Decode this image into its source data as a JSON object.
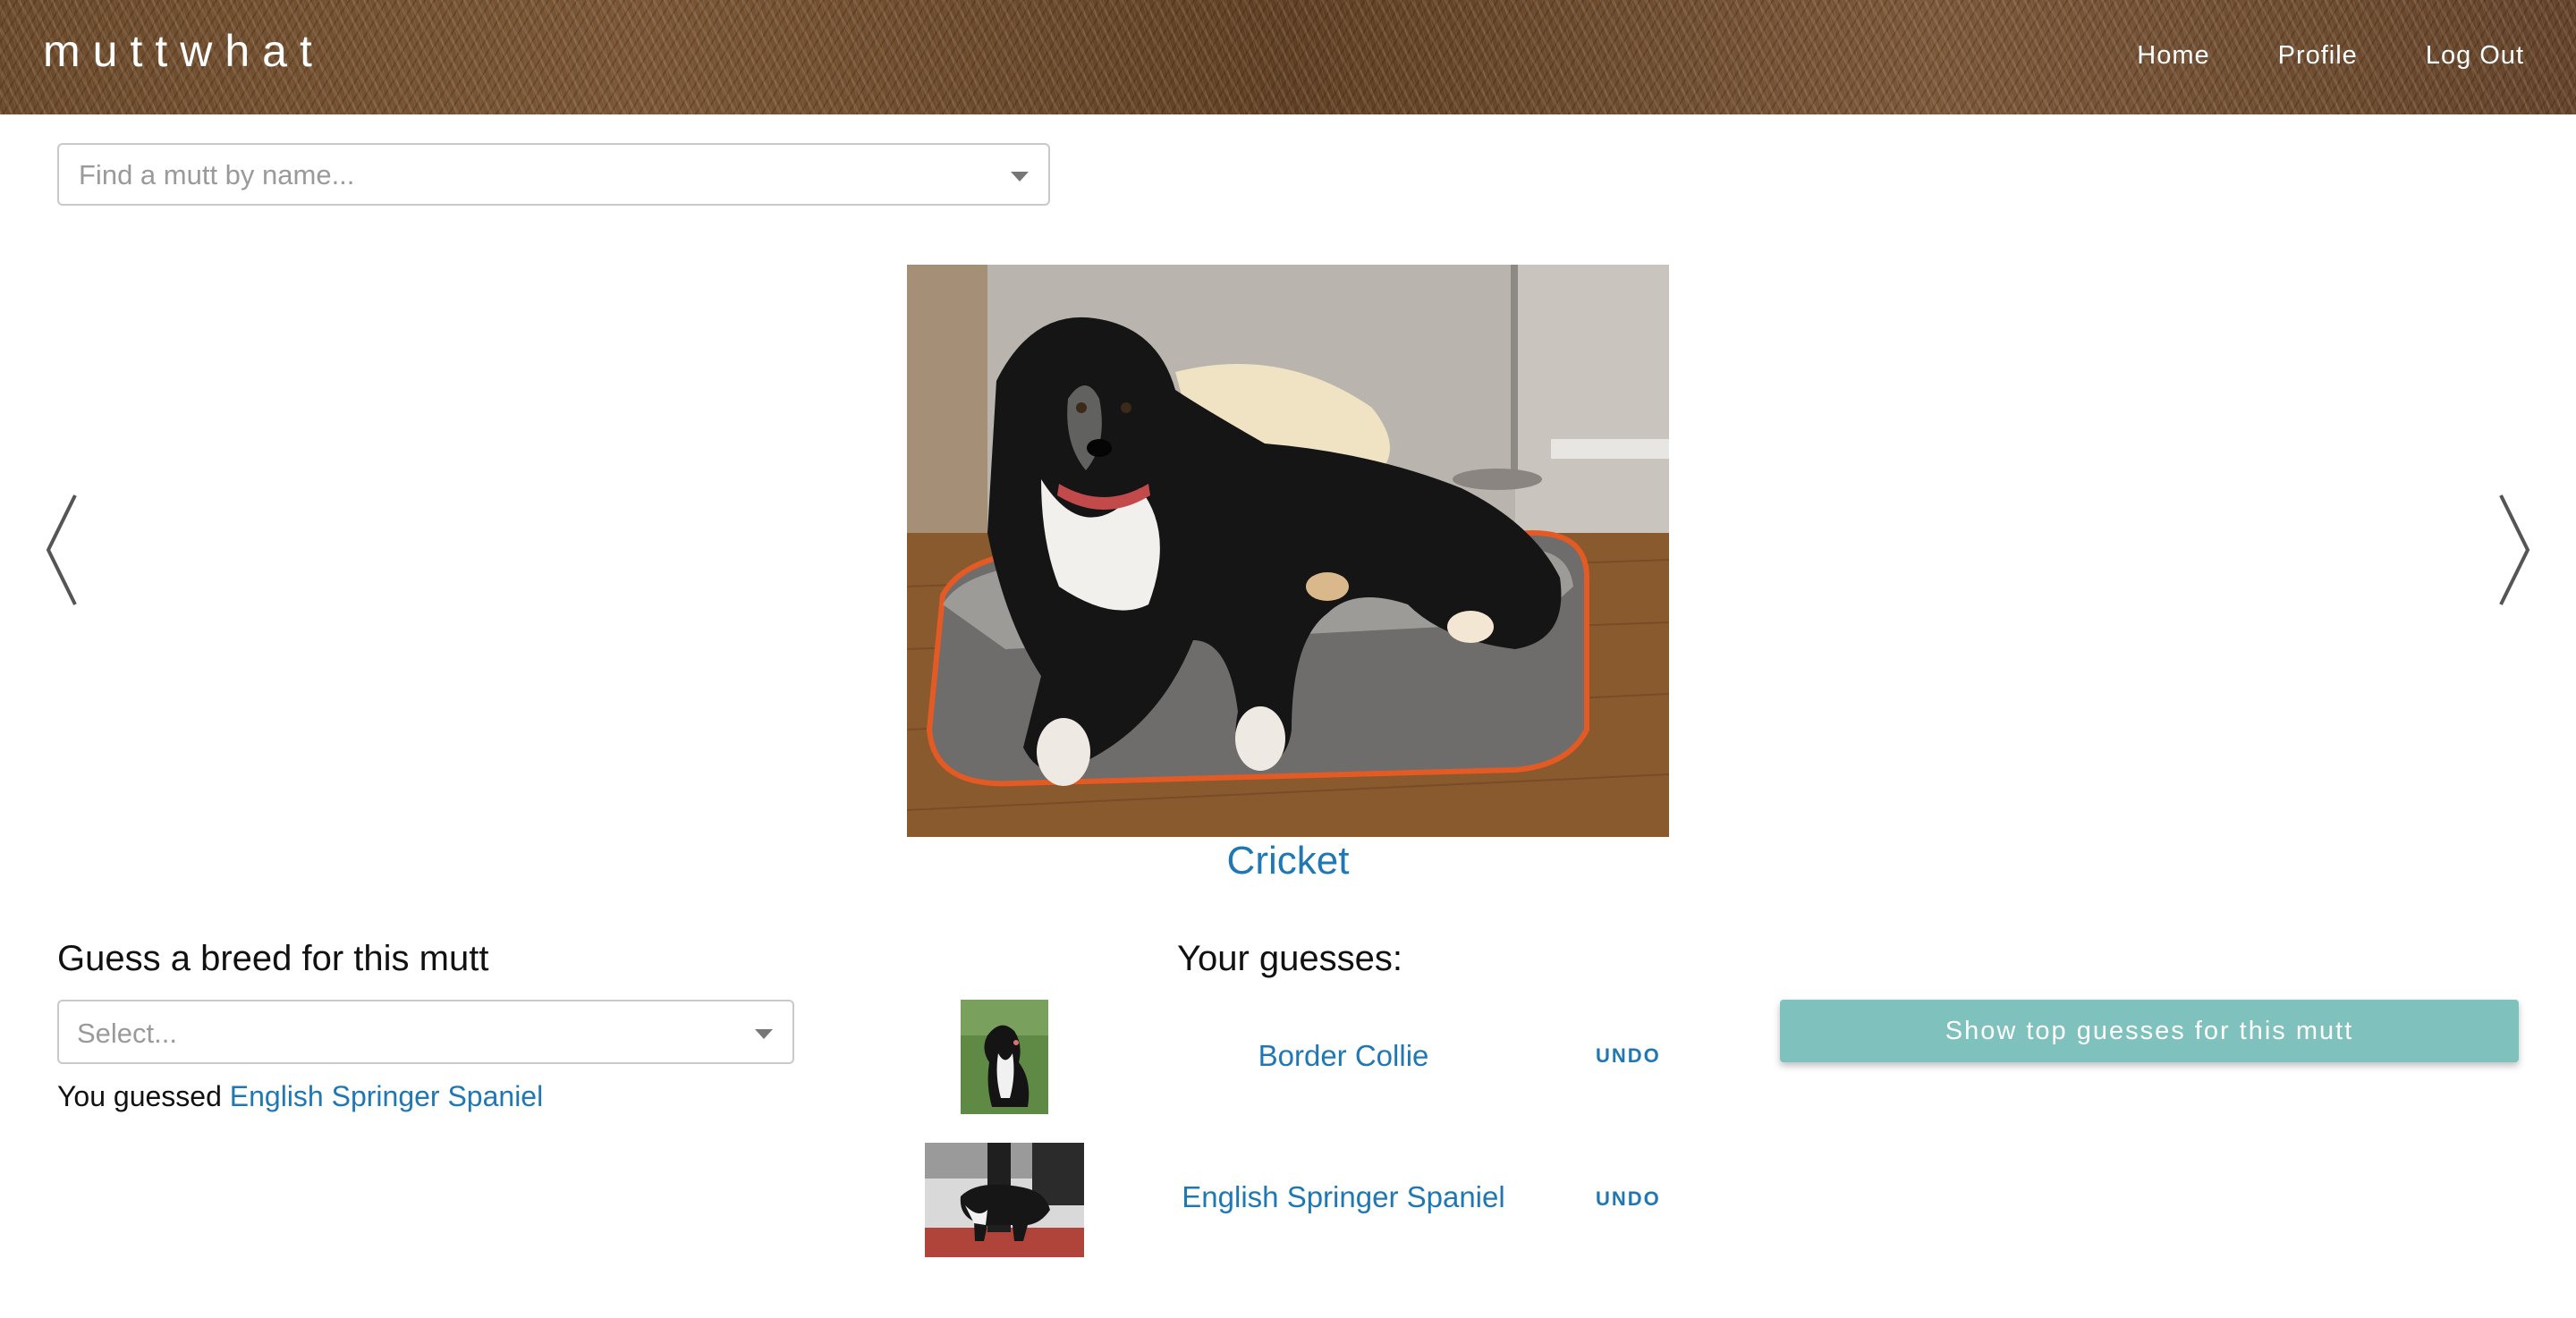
{
  "header": {
    "logo": "muttwhat",
    "nav": [
      {
        "label": "Home"
      },
      {
        "label": "Profile"
      },
      {
        "label": "Log Out"
      }
    ]
  },
  "search": {
    "placeholder": "Find a mutt by name..."
  },
  "carousel": {
    "prev_icon": "chevron-left-icon",
    "next_icon": "chevron-right-icon",
    "mutt_name": "Cricket",
    "photo_subject": "dog-photo"
  },
  "guess_form": {
    "title": "Guess a breed for this mutt",
    "select_placeholder": "Select...",
    "you_guessed_prefix": "You guessed",
    "you_guessed_breed": "English Springer Spaniel"
  },
  "your_guesses": {
    "title": "Your guesses:",
    "items": [
      {
        "breed": "Border Collie",
        "undo_label": "UNDO"
      },
      {
        "breed": "English Springer Spaniel",
        "undo_label": "UNDO"
      }
    ]
  },
  "actions": {
    "show_top_label": "Show top guesses for this mutt"
  },
  "colors": {
    "link": "#1f78b4",
    "button": "#7ec1bd"
  }
}
